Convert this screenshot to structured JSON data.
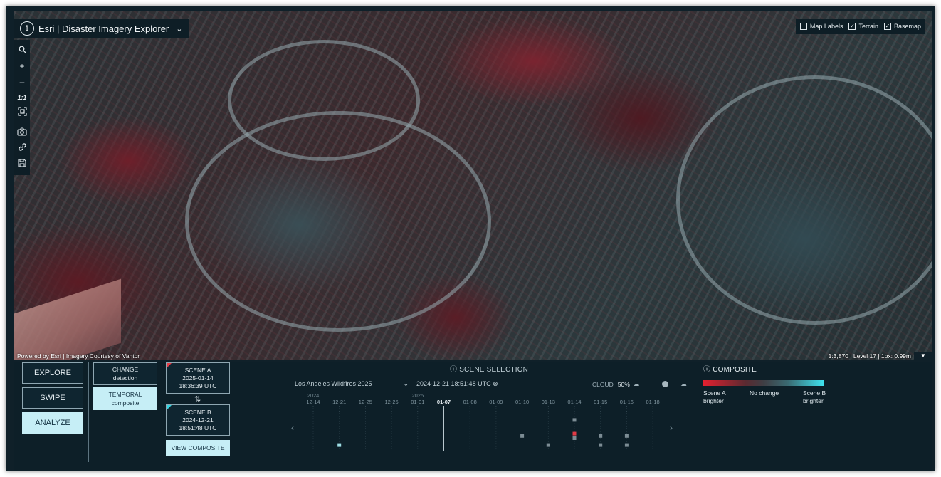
{
  "app": {
    "title": "Esri | Disaster Imagery Explorer"
  },
  "map": {
    "attribution_left": "Powered by Esri | Imagery Courtesy of Vantor",
    "attribution_right": "1:3,870 | Level 17 | 1px: 0.99m",
    "tools": [
      "search-icon",
      "zoom-in-icon",
      "zoom-out-icon",
      "one-to-one-icon",
      "fullscreen-icon",
      "screenshot-icon",
      "link-icon",
      "save-icon"
    ],
    "tool_glyphs": {
      "one_to_one": "1:1"
    },
    "layer_toggles": [
      {
        "label": "Map Labels",
        "checked": false
      },
      {
        "label": "Terrain",
        "checked": true
      },
      {
        "label": "Basemap",
        "checked": true
      }
    ]
  },
  "modes": {
    "explore": "EXPLORE",
    "swipe": "SWIPE",
    "analyze": "ANALYZE",
    "active": "analyze"
  },
  "analysis": {
    "change_line1": "CHANGE",
    "change_line2": "detection",
    "temporal_line1": "TEMPORAL",
    "temporal_line2": "composite",
    "active": "temporal"
  },
  "scenes": {
    "a": {
      "title": "SCENE A",
      "date": "2025-01-14",
      "time": "18:36:39 UTC",
      "color": "#e23a45"
    },
    "b": {
      "title": "SCENE B",
      "date": "2024-12-21",
      "time": "18:51:48 UTC",
      "color": "#34d3e0"
    },
    "view_composite": "VIEW COMPOSITE"
  },
  "scene_selection": {
    "title": "SCENE SELECTION",
    "dataset": "Los Angeles Wildfires 2025",
    "selected_date": "2024-12-21 18:51:48 UTC",
    "cloud_label": "CLOUD",
    "cloud_value": "50%",
    "years": [
      {
        "label": "2024",
        "at": 0
      },
      {
        "label": "2025",
        "at": 4
      }
    ],
    "dates": [
      "12-14",
      "12-21",
      "12-25",
      "12-26",
      "01-01",
      "01-07",
      "01-08",
      "01-09",
      "01-10",
      "01-13",
      "01-14",
      "01-15",
      "01-16",
      "01-18"
    ],
    "bold_date_index": 5,
    "scene_marks": [
      {
        "date_index": 1,
        "level": 0.1,
        "kind": "b"
      },
      {
        "date_index": 8,
        "level": 0.3,
        "kind": "n"
      },
      {
        "date_index": 9,
        "level": 0.1,
        "kind": "n"
      },
      {
        "date_index": 10,
        "level": 0.65,
        "kind": "n"
      },
      {
        "date_index": 10,
        "level": 0.35,
        "kind": "a"
      },
      {
        "date_index": 10,
        "level": 0.25,
        "kind": "n"
      },
      {
        "date_index": 11,
        "level": 0.3,
        "kind": "n"
      },
      {
        "date_index": 11,
        "level": 0.1,
        "kind": "n"
      },
      {
        "date_index": 12,
        "level": 0.3,
        "kind": "n"
      },
      {
        "date_index": 12,
        "level": 0.1,
        "kind": "n"
      }
    ]
  },
  "composite": {
    "title": "COMPOSITE",
    "left_l1": "Scene A",
    "left_l2": "brighter",
    "mid": "No change",
    "right_l1": "Scene B",
    "right_l2": "brighter"
  }
}
